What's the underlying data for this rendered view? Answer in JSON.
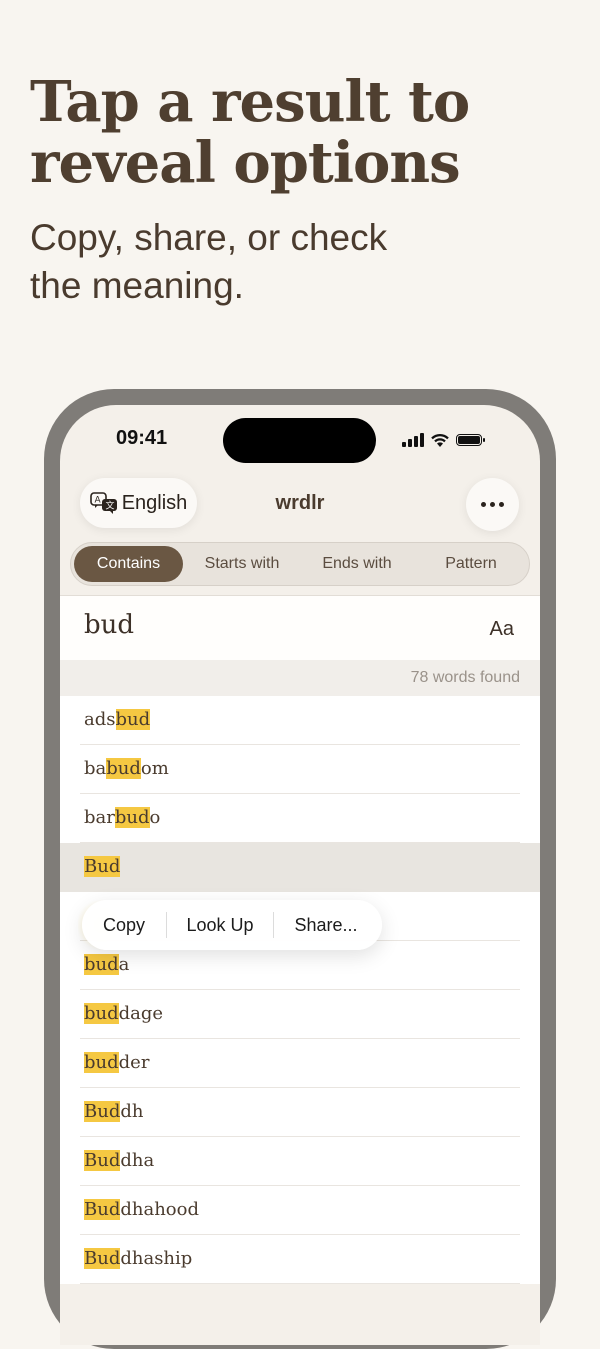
{
  "promo": {
    "headline_line1": "Tap a result to",
    "headline_line2": "reveal options",
    "subline_line1": "Copy, share, or check",
    "subline_line2": "the meaning."
  },
  "status_bar": {
    "time": "09:41"
  },
  "header": {
    "language_label": "English",
    "app_title": "wrdlr",
    "more_icon": "ellipsis-icon",
    "language_icon": "translate-icon"
  },
  "tabs": [
    {
      "label": "Contains",
      "active": true
    },
    {
      "label": "Starts with",
      "active": false
    },
    {
      "label": "Ends with",
      "active": false
    },
    {
      "label": "Pattern",
      "active": false
    }
  ],
  "search": {
    "query": "bud",
    "font_button": "Aa"
  },
  "results_count": "78 words found",
  "results": [
    {
      "pre": "ads",
      "match": "bud",
      "post": ""
    },
    {
      "pre": "ba",
      "match": "bud",
      "post": "om"
    },
    {
      "pre": "bar",
      "match": "bud",
      "post": "o"
    },
    {
      "pre": "",
      "match": "Bud",
      "post": "",
      "selected": true
    },
    {
      "pre": "",
      "match": "",
      "post": ""
    },
    {
      "pre": "",
      "match": "bud",
      "post": "a"
    },
    {
      "pre": "",
      "match": "bud",
      "post": "dage"
    },
    {
      "pre": "",
      "match": "bud",
      "post": "der"
    },
    {
      "pre": "",
      "match": "Bud",
      "post": "dh"
    },
    {
      "pre": "",
      "match": "Bud",
      "post": "dha"
    },
    {
      "pre": "",
      "match": "Bud",
      "post": "dhahood"
    },
    {
      "pre": "",
      "match": "Bud",
      "post": "dhaship"
    }
  ],
  "context_menu": {
    "copy": "Copy",
    "look_up": "Look Up",
    "share": "Share..."
  },
  "colors": {
    "background": "#f8f5f0",
    "accent": "#6a5743",
    "highlight": "#f5c842",
    "headline": "#4f3f30"
  }
}
